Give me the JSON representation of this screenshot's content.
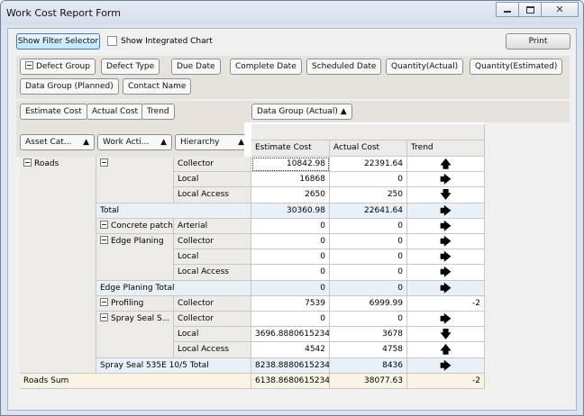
{
  "window": {
    "title": "Work Cost Report Form"
  },
  "toolbar": {
    "filter_button": "Show Filter Selector",
    "integrated_chart": "Show Integrated Chart",
    "print_button": "Print"
  },
  "filter_fields": [
    "Defect Group",
    "Defect Type",
    "Due Date",
    "Complete Date",
    "Scheduled Date",
    "Quantity(Actual)",
    "Quantity(Estimated)",
    "Data Group (Planned)",
    "Contact Name"
  ],
  "data_fields": [
    "Estimate Cost",
    "Actual Cost",
    "Trend"
  ],
  "column_field": "Data Group (Actual)",
  "row_fields": [
    "Asset Cat...",
    "Work Acti...",
    "Hierarchy"
  ],
  "column_headers": [
    "Estimate Cost",
    "Actual Cost",
    "Trend"
  ],
  "arrows": {
    "up": "🡅",
    "right": "🡆",
    "down": "🡇"
  },
  "rows": [
    {
      "a": "Roads",
      "w": "",
      "h": "Collector",
      "e": "10842.98",
      "c": "22391.64",
      "t": "up"
    },
    {
      "a": "",
      "w": "",
      "h": "Local",
      "e": "16868",
      "c": "0",
      "t": "right"
    },
    {
      "a": "",
      "w": "",
      "h": "Local Access",
      "e": "2650",
      "c": "250",
      "t": "down"
    },
    {
      "a": "",
      "w": "Total",
      "h": "",
      "e": "30360.98",
      "c": "22641.64",
      "t": "right"
    },
    {
      "a": "",
      "w": "Concrete patch",
      "h": "Arterial",
      "e": "0",
      "c": "0",
      "t": "right"
    },
    {
      "a": "",
      "w": "Edge Planing",
      "h": "Collector",
      "e": "0",
      "c": "0",
      "t": "right"
    },
    {
      "a": "",
      "w": "",
      "h": "Local",
      "e": "0",
      "c": "0",
      "t": "right"
    },
    {
      "a": "",
      "w": "",
      "h": "Local Access",
      "e": "0",
      "c": "0",
      "t": "right"
    },
    {
      "a": "",
      "w": "Edge Planing Total",
      "h": "",
      "e": "0",
      "c": "0",
      "t": "right"
    },
    {
      "a": "",
      "w": "Profiling",
      "h": "Collector",
      "e": "7539",
      "c": "6999.99",
      "t": "-2"
    },
    {
      "a": "",
      "w": "Spray Seal S...",
      "h": "Collector",
      "e": "0",
      "c": "0",
      "t": "right"
    },
    {
      "a": "",
      "w": "",
      "h": "Local",
      "e": "3696.88806152344",
      "c": "3678",
      "t": "down"
    },
    {
      "a": "",
      "w": "",
      "h": "Local Access",
      "e": "4542",
      "c": "4758",
      "t": "up"
    },
    {
      "a": "",
      "w": "Spray Seal 535E 10/5 Total",
      "h": "",
      "e": "8238.88806152344",
      "c": "8436",
      "t": "right"
    }
  ],
  "sum_row": {
    "label": "Roads Sum",
    "e": "6138.86806152344",
    "c": "38077.63",
    "t": "-2"
  },
  "status_dots": "::::"
}
